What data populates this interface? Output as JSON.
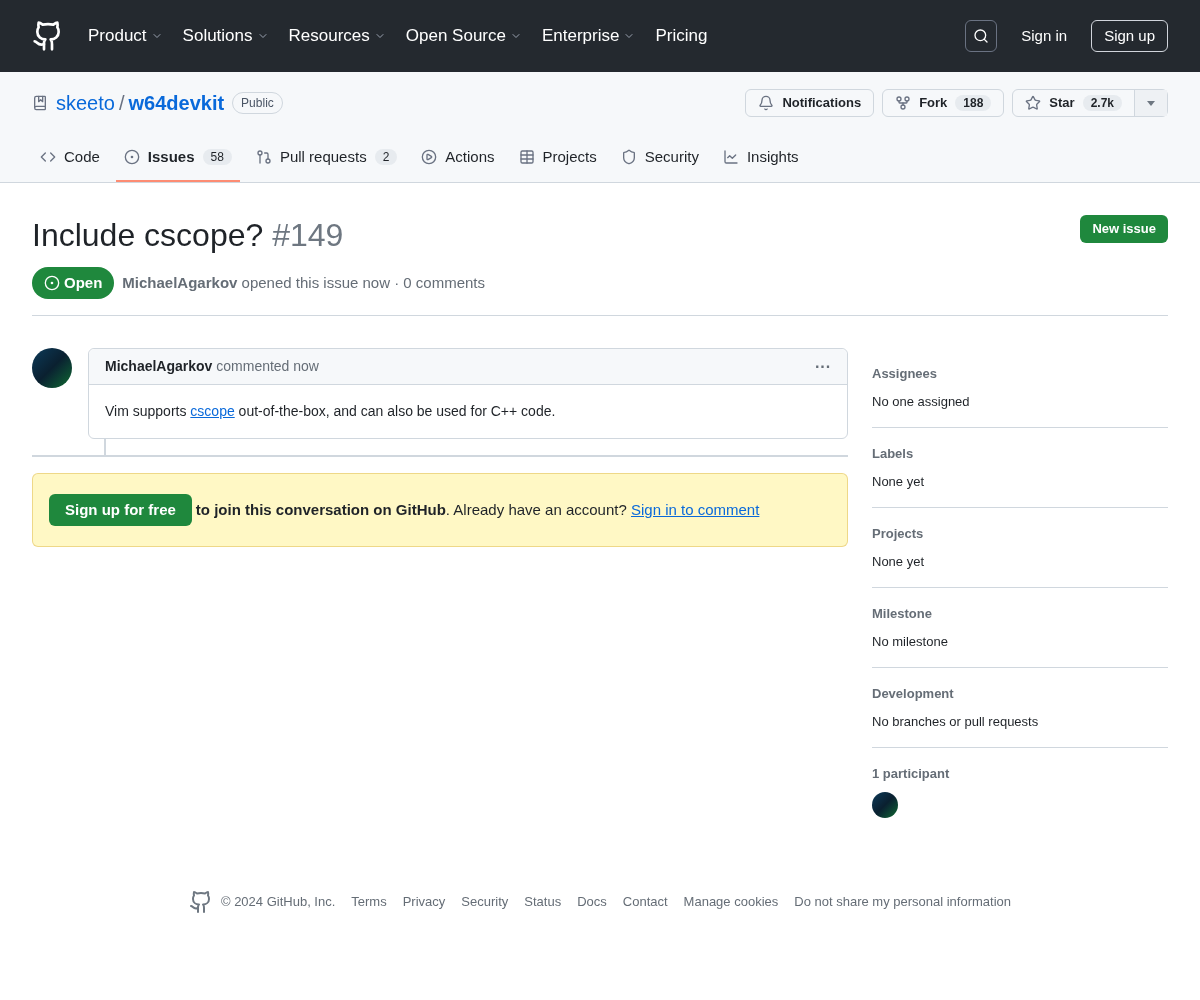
{
  "nav": {
    "items": [
      {
        "label": "Product",
        "dropdown": true
      },
      {
        "label": "Solutions",
        "dropdown": true
      },
      {
        "label": "Resources",
        "dropdown": true
      },
      {
        "label": "Open Source",
        "dropdown": true
      },
      {
        "label": "Enterprise",
        "dropdown": true
      },
      {
        "label": "Pricing",
        "dropdown": false
      }
    ],
    "sign_in": "Sign in",
    "sign_up": "Sign up"
  },
  "repo": {
    "owner": "skeeto",
    "separator": "/",
    "name": "w64devkit",
    "visibility": "Public",
    "notifications": "Notifications",
    "fork": {
      "label": "Fork",
      "count": "188"
    },
    "star": {
      "label": "Star",
      "count": "2.7k"
    }
  },
  "tabs": [
    {
      "label": "Code",
      "selected": false
    },
    {
      "label": "Issues",
      "count": "58",
      "selected": true
    },
    {
      "label": "Pull requests",
      "count": "2",
      "selected": false
    },
    {
      "label": "Actions",
      "selected": false
    },
    {
      "label": "Projects",
      "selected": false
    },
    {
      "label": "Security",
      "selected": false
    },
    {
      "label": "Insights",
      "selected": false
    }
  ],
  "issue": {
    "title": "Include cscope?",
    "number": "#149",
    "state": "Open",
    "open": true,
    "author": "MichaelAgarkov",
    "meta": "opened this issue now",
    "separator": "·",
    "comments": "0 comments",
    "new_issue": "New issue"
  },
  "comment": {
    "author": "MichaelAgarkov",
    "time": "commented now",
    "menu": "···",
    "body_before": "Vim supports",
    "link": "cscope",
    "body_after": "out-of-the-box, and can also be used for C++ code."
  },
  "banner": {
    "button": "Sign up for free",
    "bold": "to join this conversation on GitHub",
    "text": ". Already have an account?",
    "link": "Sign in to comment"
  },
  "sidebar": [
    {
      "title": "Assignees",
      "value": "No one assigned"
    },
    {
      "title": "Labels",
      "value": "None yet"
    },
    {
      "title": "Projects",
      "value": "None yet"
    },
    {
      "title": "Milestone",
      "value": "No milestone"
    },
    {
      "title": "Development",
      "value": "No branches or pull requests"
    }
  ],
  "participants": {
    "title": "1 participant"
  },
  "footer": {
    "copyright": "© 2024 GitHub, Inc.",
    "links": [
      "Terms",
      "Privacy",
      "Security",
      "Status",
      "Docs",
      "Contact",
      "Manage cookies",
      "Do not share my personal information"
    ]
  }
}
